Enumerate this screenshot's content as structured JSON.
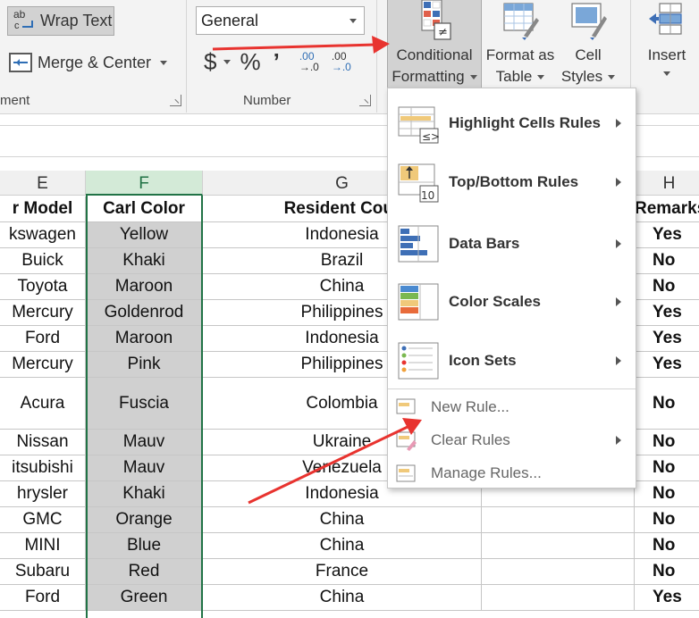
{
  "ribbon": {
    "wrap_text": "Wrap Text",
    "merge_center": "Merge & Center",
    "alignment_label": "ment",
    "number_format_value": "General",
    "currency_symbol": "$",
    "percent_symbol": "%",
    "comma_symbol": "’",
    "increase_decimal": [
      ".00",
      "→.0"
    ],
    "decrease_decimal": [
      ".00",
      "→.0"
    ],
    "number_label": "Number",
    "conditional_formatting": [
      "Conditional",
      "Formatting"
    ],
    "format_as_table": [
      "Format as",
      "Table"
    ],
    "cell_styles": [
      "Cell",
      "Styles"
    ],
    "insert": "Insert"
  },
  "columns": {
    "e": "E",
    "f": "F",
    "g": "G",
    "h": "H"
  },
  "headers": {
    "model": "r Model",
    "color": "Carl Color",
    "country": "Resident Cour",
    "remarks": "Remarks"
  },
  "rows": [
    {
      "model": "kswagen",
      "color": "Yellow",
      "country": "Indonesia",
      "remarks": "Yes"
    },
    {
      "model": "Buick",
      "color": "Khaki",
      "country": "Brazil",
      "remarks": "No"
    },
    {
      "model": "Toyota",
      "color": "Maroon",
      "country": "China",
      "remarks": "No"
    },
    {
      "model": "Mercury",
      "color": "Goldenrod",
      "country": "Philippines",
      "remarks": "Yes"
    },
    {
      "model": "Ford",
      "color": "Maroon",
      "country": "Indonesia",
      "remarks": "Yes"
    },
    {
      "model": "Mercury",
      "color": "Pink",
      "country": "Philippines",
      "remarks": "Yes"
    },
    {
      "model": "Acura",
      "color": "Fuscia",
      "country": "Colombia",
      "remarks": "No"
    },
    {
      "model": "Nissan",
      "color": "Mauv",
      "country": "Ukraine",
      "remarks": "No"
    },
    {
      "model": "itsubishi",
      "color": "Mauv",
      "country": "Venezuela",
      "remarks": "No"
    },
    {
      "model": "hrysler",
      "color": "Khaki",
      "country": "Indonesia",
      "remarks": "No"
    },
    {
      "model": "GMC",
      "color": "Orange",
      "country": "China",
      "remarks": "No"
    },
    {
      "model": "MINI",
      "color": "Blue",
      "country": "China",
      "remarks": "No"
    },
    {
      "model": "Subaru",
      "color": "Red",
      "country": "France",
      "remarks": "No"
    },
    {
      "model": "Ford",
      "color": "Green",
      "country": "China",
      "remarks": "Yes"
    }
  ],
  "menu": {
    "highlight": "Highlight Cells Rules",
    "topbottom": "Top/Bottom Rules",
    "databars": "Data Bars",
    "colorscales": "Color Scales",
    "iconsets": "Icon Sets",
    "newrule": "New Rule...",
    "clearrules": "Clear Rules",
    "managerules": "Manage Rules...",
    "topbottom_icon_number": "10",
    "highlight_icon_symbol": "≤>"
  },
  "colors": {
    "accent_green": "#217346",
    "annotation_red": "#e8332f",
    "selected_fill": "#d0d0d0"
  }
}
